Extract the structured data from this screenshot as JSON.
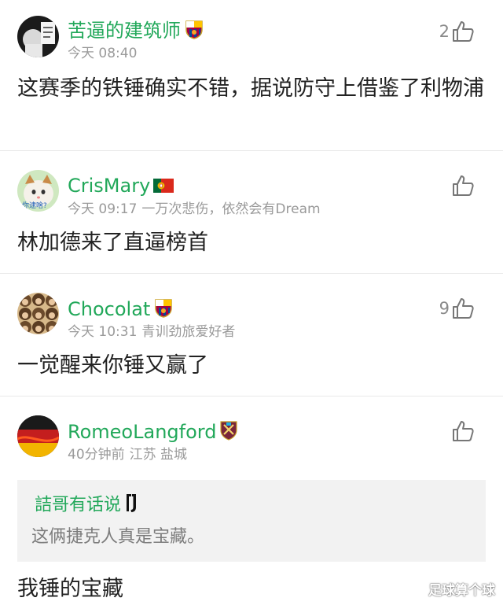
{
  "comments": [
    {
      "username": "苦逼的建筑师",
      "badge": "barcelona-badge",
      "time": "今天 08:40",
      "location": "",
      "likes": "2",
      "text": "这赛季的铁锤确实不错，据说防守上借鉴了利物浦"
    },
    {
      "username": "CrisMary",
      "badge": "portugal-flag",
      "time": "今天 09:17",
      "location": "一万次悲伤，依然会有Dream",
      "likes": "",
      "text": "林加德来了直逼榜首",
      "avatar_caption": "你逮啥?"
    },
    {
      "username": "Chocolat",
      "badge": "barcelona-badge",
      "time": "今天 10:31",
      "location": "青训劲旅爱好者",
      "likes": "9",
      "text": "一觉醒来你锤又赢了"
    },
    {
      "username": "RomeoLangford",
      "badge": "west-ham-badge",
      "time": "40分钟前",
      "location": "江苏 盐城",
      "likes": "",
      "quote": {
        "username": "詰哥有话说",
        "badge": "juventus-badge",
        "text": "这俩捷克人真是宝藏。"
      },
      "text": "我锤的宝藏"
    }
  ],
  "watermark": "足球算个球",
  "colors": {
    "username": "#22a85a",
    "meta": "#9a9a9a",
    "text": "#222222",
    "quote_bg": "#f2f2f2"
  }
}
